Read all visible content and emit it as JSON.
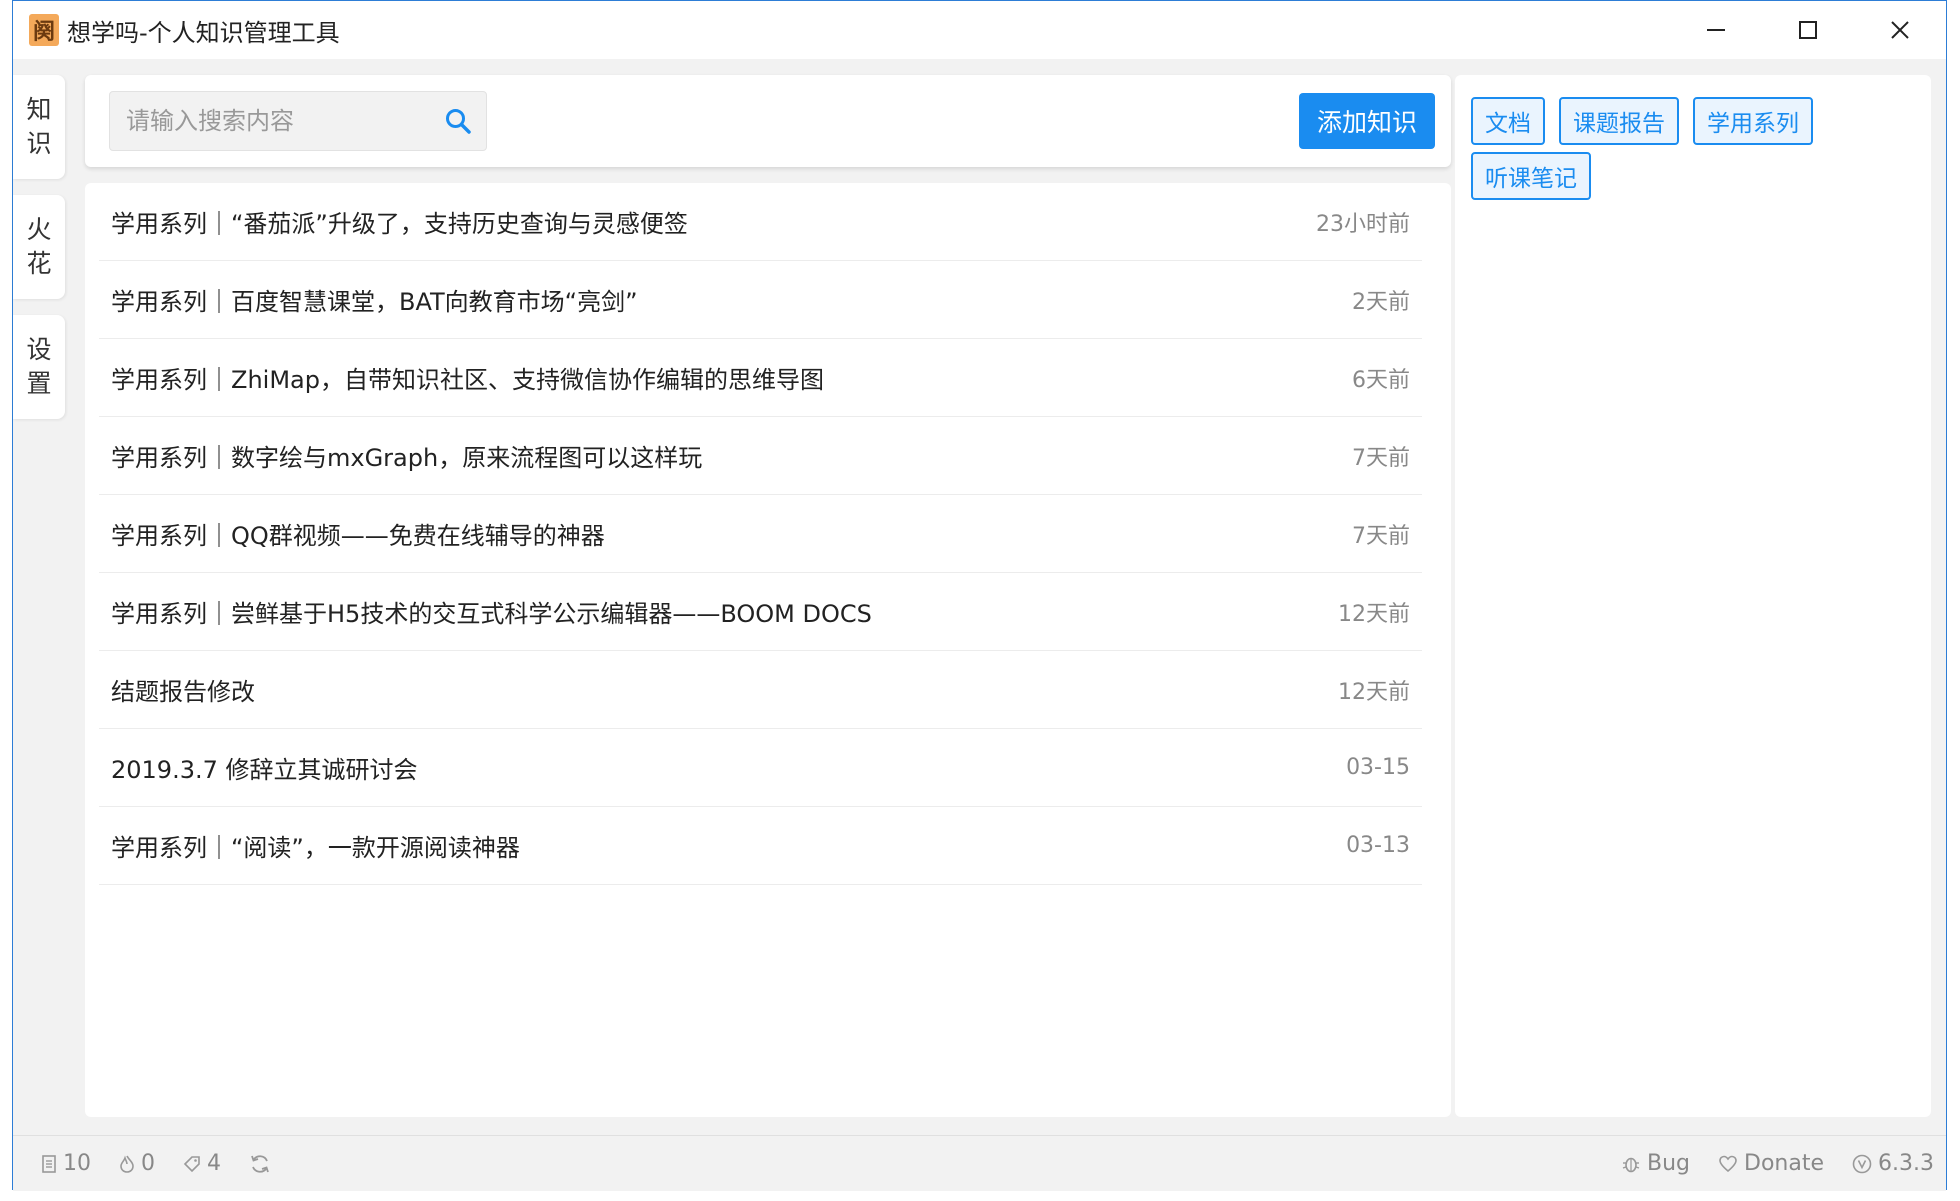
{
  "window": {
    "title": "想学吗-个人知识管理工具",
    "logo_glyph": "阕"
  },
  "left_nav": [
    {
      "label_top": "知",
      "label_bottom": "识"
    },
    {
      "label_top": "火",
      "label_bottom": "花"
    },
    {
      "label_top": "设",
      "label_bottom": "置"
    }
  ],
  "search": {
    "placeholder": "请输入搜索内容",
    "icon": "search-icon"
  },
  "toolbar": {
    "add_label": "添加知识"
  },
  "knowledge_list": [
    {
      "title": "学用系列｜“番茄派”升级了，支持历史查询与灵感便签",
      "time": "23小时前"
    },
    {
      "title": "学用系列｜百度智慧课堂，BAT向教育市场“亮剑”",
      "time": "2天前"
    },
    {
      "title": "学用系列｜ZhiMap，自带知识社区、支持微信协作编辑的思维导图",
      "time": "6天前"
    },
    {
      "title": "学用系列｜数字绘与mxGraph，原来流程图可以这样玩",
      "time": "7天前"
    },
    {
      "title": "学用系列｜QQ群视频——免费在线辅导的神器",
      "time": "7天前"
    },
    {
      "title": "学用系列｜尝鲜基于H5技术的交互式科学公示编辑器——BOOM DOCS",
      "time": "12天前"
    },
    {
      "title": "结题报告修改",
      "time": "12天前"
    },
    {
      "title": "2019.3.7 修辞立其诚研讨会",
      "time": "03-15"
    },
    {
      "title": "学用系列｜“阅读”，一款开源阅读神器",
      "time": "03-13"
    }
  ],
  "tags": [
    "文档",
    "课题报告",
    "学用系列",
    "听课笔记"
  ],
  "status_bar": {
    "doc_count": "10",
    "spark_count": "0",
    "tag_count": "4",
    "bug_label": "Bug",
    "donate_label": "Donate",
    "version": "6.3.3"
  },
  "colors": {
    "accent": "#1a8cf0",
    "window_border": "#2d7dd6",
    "background": "#f2f2f2"
  }
}
